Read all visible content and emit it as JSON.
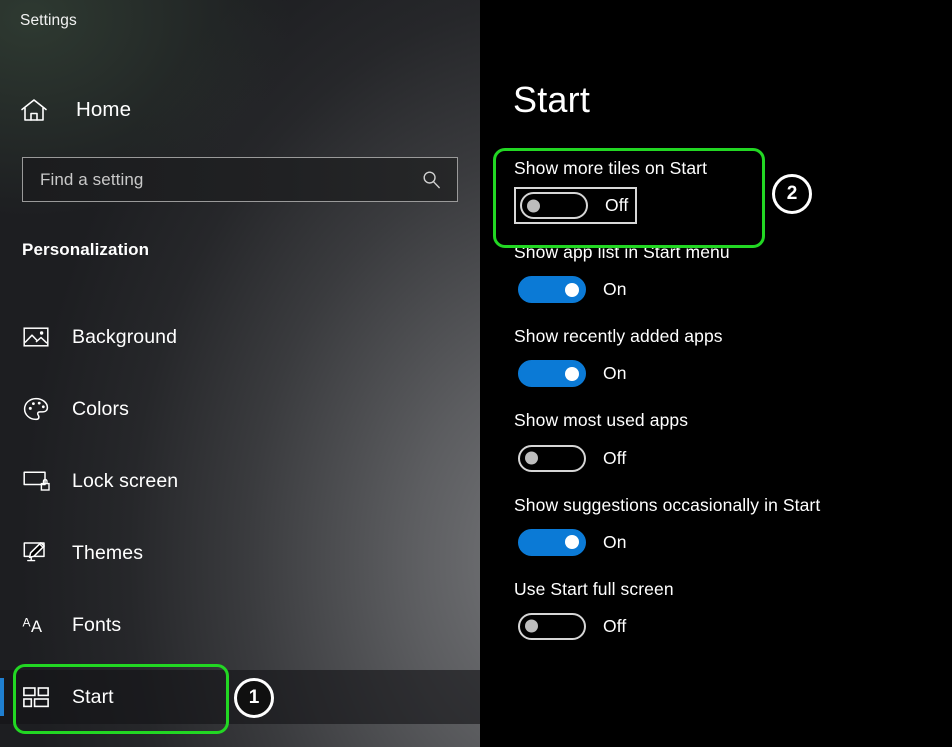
{
  "window": {
    "title": "Settings"
  },
  "sidebar": {
    "home": {
      "label": "Home",
      "icon": "home-icon"
    },
    "search": {
      "placeholder": "Find a setting",
      "value": "",
      "icon": "search-icon"
    },
    "section_heading": "Personalization",
    "items": [
      {
        "label": "Background",
        "icon": "image-icon",
        "selected": false
      },
      {
        "label": "Colors",
        "icon": "palette-icon",
        "selected": false
      },
      {
        "label": "Lock screen",
        "icon": "lock-screen-icon",
        "selected": false
      },
      {
        "label": "Themes",
        "icon": "themes-brush-icon",
        "selected": false
      },
      {
        "label": "Fonts",
        "icon": "fonts-aa-icon",
        "selected": false
      },
      {
        "label": "Start",
        "icon": "start-tiles-icon",
        "selected": true
      }
    ]
  },
  "main": {
    "page_title": "Start",
    "settings": [
      {
        "label": "Show more tiles on Start",
        "state": "Off",
        "on": false,
        "focused": true,
        "highlighted": true
      },
      {
        "label": "Show app list in Start menu",
        "state": "On",
        "on": true,
        "focused": false,
        "highlighted": false
      },
      {
        "label": "Show recently added apps",
        "state": "On",
        "on": true,
        "focused": false,
        "highlighted": false
      },
      {
        "label": "Show most used apps",
        "state": "Off",
        "on": false,
        "focused": false,
        "highlighted": false
      },
      {
        "label": "Show suggestions occasionally in Start",
        "state": "On",
        "on": true,
        "focused": false,
        "highlighted": false
      },
      {
        "label": "Use Start full screen",
        "state": "Off",
        "on": false,
        "focused": false,
        "highlighted": false
      }
    ]
  },
  "annotations": {
    "badges": [
      {
        "number": "1",
        "target": "sidebar-item-start"
      },
      {
        "number": "2",
        "target": "setting-show-more-tiles"
      }
    ],
    "highlight_color": "#22d723"
  },
  "colors": {
    "accent_blue": "#0b7ad6",
    "selection_bar": "#1f7fd0",
    "annotation_green": "#22d723",
    "panel_background": "#000000",
    "text_primary": "#ffffff"
  }
}
